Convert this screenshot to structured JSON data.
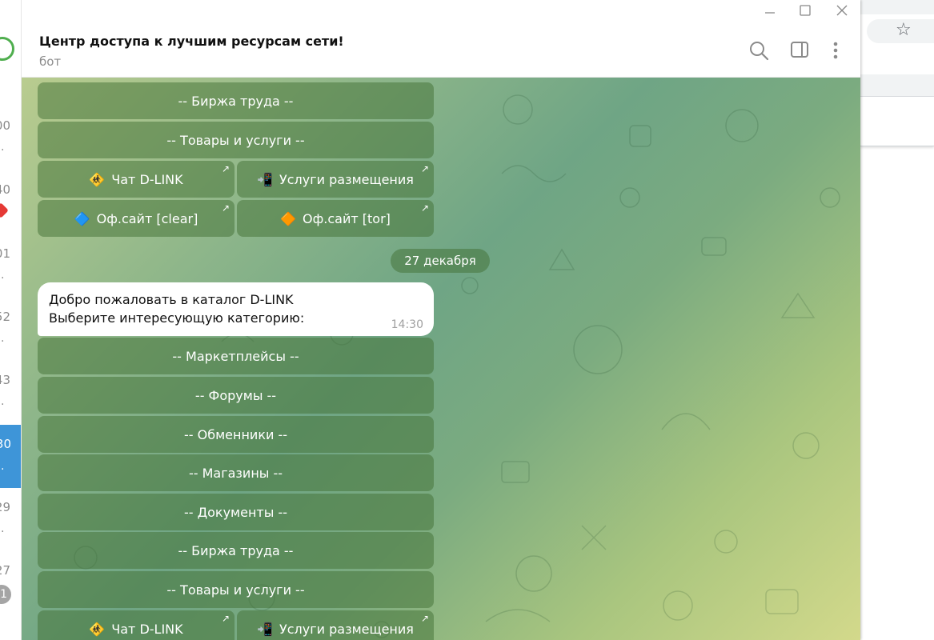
{
  "window": {
    "minimize_symbol": "—",
    "maximize_symbol": "☐",
    "close_symbol": "✕"
  },
  "chat_list": {
    "times": [
      "00",
      "40",
      "01",
      "52",
      "43",
      "30",
      "29",
      "27"
    ],
    "unread_badge": "1"
  },
  "header": {
    "title": "Центр доступа к лучшим ресурсам сети!",
    "subtitle": "бот"
  },
  "keyboard_top": {
    "rows": [
      {
        "label": "-- Биржа труда --"
      },
      {
        "label": "-- Товары и услуги --"
      }
    ],
    "chat_button": {
      "icon": "🚸",
      "label": "Чат D-LINK"
    },
    "placement_button": {
      "icon": "📲",
      "label": "Услуги размещения"
    },
    "site_clear_button": {
      "icon": "🔷",
      "label": "Оф.сайт [clear]"
    },
    "site_tor_button": {
      "icon": "🔶",
      "label": "Оф.сайт [tor]"
    },
    "arrow": "↗"
  },
  "date_separator": "27 декабря",
  "message": {
    "line1": "Добро пожаловать в каталог D-LINK",
    "line2": "Выберите интересующую категорию:",
    "time": "14:30"
  },
  "keyboard_bottom": {
    "rows": [
      {
        "label": "-- Маркетплейсы --"
      },
      {
        "label": "-- Форумы --"
      },
      {
        "label": "-- Обменники --"
      },
      {
        "label": "-- Магазины --"
      },
      {
        "label": "-- Документы --"
      },
      {
        "label": "-- Биржа труда --"
      },
      {
        "label": "-- Товары и услуги --"
      }
    ],
    "chat_button": {
      "icon": "🚸",
      "label": "Чат D-LINK"
    },
    "placement_button": {
      "icon": "📲",
      "label": "Услуги размещения"
    },
    "arrow": "↗"
  },
  "browser_bg": {
    "star_icon": "☆"
  },
  "colors": {
    "active_chat": "#3e95d8",
    "button_bg": "rgba(66,112,52,0.50)",
    "message_bg": "#ffffff"
  }
}
